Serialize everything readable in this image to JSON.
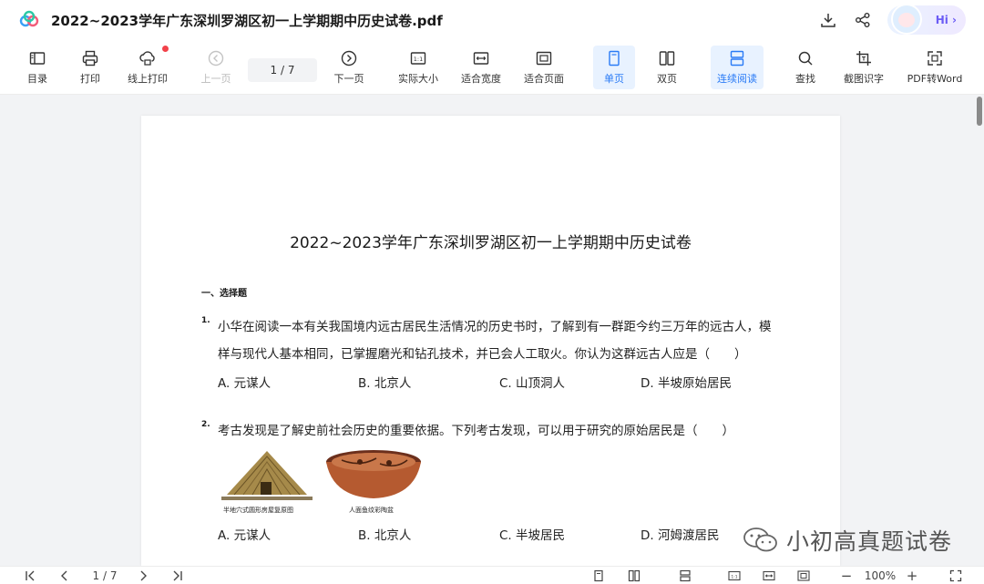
{
  "window": {
    "title": "2022~2023学年广东深圳罗湖区初一上学期期中历史试卷.pdf",
    "ai_badge_label": "Hi ›"
  },
  "toolbar": {
    "toc": "目录",
    "print": "打印",
    "online_print": "线上打印",
    "prev_page": "上一页",
    "page_indicator": "1 / 7",
    "next_page": "下一页",
    "actual_size": "实际大小",
    "fit_width": "适合宽度",
    "fit_page": "适合页面",
    "single_page": "单页",
    "double_page": "双页",
    "continuous_read": "连续阅读",
    "find": "查找",
    "screenshot_ocr": "截图识字",
    "pdf_to_word": "PDF转Word"
  },
  "document": {
    "title": "2022~2023学年广东深圳罗湖区初一上学期期中历史试卷",
    "section": "一、选择题",
    "questions": [
      {
        "number": "1.",
        "lines": [
          "小华在阅读一本有关我国境内远古居民生活情况的历史书时，了解到有一群距今约三万年的远古人，模",
          "样与现代人基本相同，已掌握磨光和钻孔技术，并已会人工取火。你认为这群远古人应是（　　）"
        ],
        "options": [
          "A. 元谋人",
          "B. 北京人",
          "C. 山顶洞人",
          "D. 半坡原始居民"
        ]
      },
      {
        "number": "2.",
        "lines": [
          "考古发现是了解史前社会历史的重要依据。下列考古发现，可以用于研究的原始居民是（　　）"
        ],
        "figures": [
          {
            "caption": "半地穴式圆形房屋复原图"
          },
          {
            "caption": "人面鱼纹彩陶盆"
          }
        ],
        "options": [
          "A. 元谋人",
          "B. 北京人",
          "C. 半坡居民",
          "D. 河姆渡居民"
        ]
      }
    ]
  },
  "watermark": {
    "text": "小初高真题试卷"
  },
  "bottombar": {
    "page_indicator": "1 / 7",
    "zoom": "100%",
    "zoom_out": "−",
    "zoom_in": "+"
  },
  "colors": {
    "accent": "#2a7bf6",
    "active_bg": "#e8f2ff",
    "notification_dot": "#f2424a"
  }
}
